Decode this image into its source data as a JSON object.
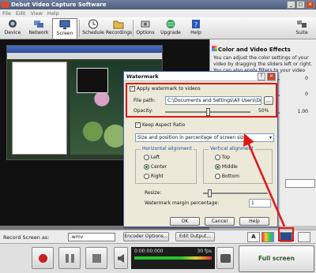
{
  "window": {
    "title": "Debut Video Capture Software"
  },
  "menu": [
    "File",
    "Edit",
    "View",
    "Help"
  ],
  "toolbar": {
    "device": "Device",
    "network": "Network",
    "screen": "Screen",
    "schedule": "Schedule",
    "recordings": "Recordings",
    "options": "Options",
    "upgrade": "Upgrade",
    "help": "Help",
    "suite": "Suite"
  },
  "panel": {
    "title": "Color and Video Effects",
    "desc": "You can adjust the color settings of your video by dragging the sliders left or right. You can also apply filters to your video",
    "values": [
      "0",
      "0",
      "1.00"
    ]
  },
  "recbar": {
    "label": "Record Screen as:",
    "format": ".wmv",
    "encoder": "Encoder Options...",
    "edit_output": "Edit Output..."
  },
  "controls": {
    "timecode": "0:00:00:000",
    "fps": "30 fps",
    "fullscreen": "Full screen"
  },
  "watermark": {
    "title": "Watermark",
    "apply_label": "Apply watermark to videos",
    "file_label": "File path:",
    "file_path": "C:\\Documents and Settings\\All Users\\Documen",
    "browse": "...",
    "opacity_label": "Opacity:",
    "opacity_value": "50%",
    "opacity": 0.5,
    "keep_aspect": "Keep Aspect Ratio",
    "size_mode": "Size and position in percentage of screen size",
    "h_align": {
      "title": "Horizontal alignment",
      "options": [
        "Left",
        "Center",
        "Right"
      ],
      "selected": "Center"
    },
    "v_align": {
      "title": "Vertical alignment",
      "options": [
        "Top",
        "Middle",
        "Bottom"
      ],
      "selected": "Middle"
    },
    "resize_label": "Resize:",
    "margin_label": "Watermark margin percentage:",
    "margin_value": "1",
    "ok": "OK",
    "cancel": "Cancel",
    "help": "Help"
  },
  "colors": {
    "highlight": "#e01616",
    "accent": "#2a5a2a"
  }
}
